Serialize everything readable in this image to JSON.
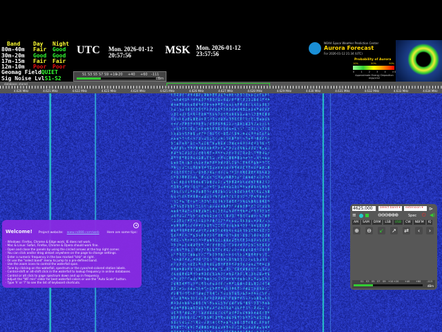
{
  "propagation": {
    "headers": [
      "Band",
      "Day",
      "Night"
    ],
    "rows": [
      [
        "80m-40m",
        "Fair",
        "Good"
      ],
      [
        "30m-20m",
        "Good",
        "Good"
      ],
      [
        "17m-15m",
        "Fair",
        "Fair"
      ],
      [
        "12m-10m",
        "Poor",
        "Poor"
      ]
    ],
    "geomag_label": "Geomag Field",
    "geomag_value": "QUIET",
    "noise_label": "Sig Noise Lvl",
    "noise_value": "S1-S2"
  },
  "clocks": [
    {
      "zone": "UTC",
      "day": "Mon. 2026-01-12",
      "time": "20:57:56"
    },
    {
      "zone": "MSK",
      "day": "Mon. 2026-01-12",
      "time": "23:57:56"
    }
  ],
  "smeter": {
    "labels": [
      "S1",
      "S3",
      "S5",
      "S7",
      "S9",
      "+10",
      "+20",
      "+40",
      "+60",
      "-111"
    ],
    "unit": "dBm",
    "level_fraction": 0.3
  },
  "aurora": {
    "agency": "NOAA Space Weather Prediction Center",
    "title": "Aurora Forecast",
    "forecast_for": "For 2026-01-12 21:34 (UTC)",
    "prob_label": "Probability of Aurora",
    "prob_ticks": [
      "10%",
      "50%",
      "90%"
    ],
    "energy_ticks": [
      "0",
      "1",
      "2",
      "3",
      "4",
      ">4"
    ],
    "energy_label": "Approximate Energy Deposition",
    "energy_unit": "ergs/cm2"
  },
  "scale": {
    "db_status": "database: stored",
    "labels": [
      "4.620 MHz",
      "4.621 MHz",
      "4.622 MHz",
      "4.623 MHz",
      "4.624 MHz",
      "4.625 MHz",
      "4.626 MHz",
      "4.627 MHz",
      "4.628 MHz",
      "4.629 MHz",
      "4.630 MHz",
      "4.631 MHz",
      "4.632 MHz",
      "4.633 MHz",
      "4.634 MHz"
    ],
    "passband_color": "#33cc33"
  },
  "welcome": {
    "title": "Welcome!",
    "project_label": "Project website:",
    "project_link": "www.rx888.com/web",
    "tips_label": "Here are some tips:",
    "tips": [
      "Windows: Firefox, Chrome & Edge work; IE does not work.",
      "Mac & Linux: Safari, Firefox, Chrome & Opera should work fine.",
      "Open and close the panels by using the circled arrows at the top right corner.",
      "You can click and/or drag almost anywhere on the page to change settings.",
      "Enter a numeric frequency in the box marked \"kHz\" at right.",
      "Or use the \"select band\" menu to jump to a pre-defined band.",
      "Use the zoom icons to control the waterfall span.",
      "Tune by clicking on the waterfall, spectrum or the cyan/red-colored station labels.",
      "Control-shift or alt-shift click in the waterfall to lookup frequency in online databases.",
      "Control or alt click to page spectrum down and up in frequency.",
      "Adjust the \"WF min\" slider for best waterfall colors or use the \"Auto Scale\" button.",
      "Type 'h' or '?' to see the list of keyboard shortcuts."
    ]
  },
  "control": {
    "frequency": "4625.000",
    "band_select": "select band",
    "ext_select": "extension",
    "spec_label": "Spec",
    "modes": [
      "AM",
      "SAM",
      "DRM",
      "LSB",
      "USB",
      "CW",
      "NBFM",
      "IQ"
    ],
    "active_mode": "USB",
    "smeter_labels": [
      "S1",
      "S3",
      "S5",
      "S7",
      "S9",
      "+10",
      "+20",
      "+40",
      "+60",
      "-113"
    ],
    "smeter_unit": "dBm"
  }
}
